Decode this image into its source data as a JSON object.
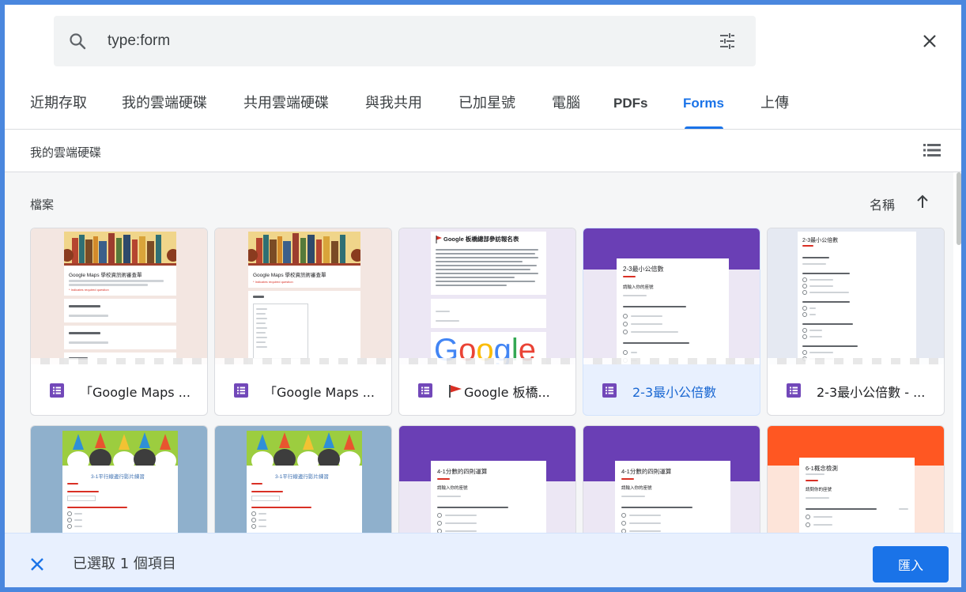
{
  "search": {
    "query": "type:form"
  },
  "tabs": [
    {
      "label": "近期存取"
    },
    {
      "label": "我的雲端硬碟"
    },
    {
      "label": "共用雲端硬碟"
    },
    {
      "label": "與我共用"
    },
    {
      "label": "已加星號"
    },
    {
      "label": "電腦"
    },
    {
      "label": "PDFs"
    },
    {
      "label": "Forms",
      "active": true
    },
    {
      "label": "上傳"
    }
  ],
  "breadcrumb": "我的雲端硬碟",
  "files_section": {
    "label": "檔案",
    "sort_label": "名稱"
  },
  "cards": [
    {
      "title": "「Google Maps ...",
      "selected": false
    },
    {
      "title": "「Google Maps ...",
      "selected": false
    },
    {
      "title": "Google 板橋...",
      "selected": false
    },
    {
      "title": "2-3最小公倍數",
      "selected": true
    },
    {
      "title": "2-3最小公倍數 - ...",
      "selected": false
    }
  ],
  "thumb_text": {
    "maps_form_title": "Google Maps 學校資訊術審查單",
    "maps_form_note": "* Indicates required question",
    "google_form_header": "Google 板橋總部參訪報名表",
    "google_logo": "Google",
    "lcm_form_title": "2-3最小公倍數",
    "lcm_name_q": "請輸入你的座號",
    "cat_form_title": "3-1平行線邊行影片練習",
    "div_form_title": "4-1分數的四則運算",
    "div_name_q": "請輸入你的座號",
    "concept_form_title": "6-1概念檢測",
    "concept_name_q": "請問你的座號"
  },
  "selection_bar": {
    "text": "已選取 1 個項目",
    "import_label": "匯入"
  },
  "colors": {
    "accent": "#1a73e8",
    "forms_purple": "#7248b9",
    "frame_blue": "#4a87de"
  }
}
